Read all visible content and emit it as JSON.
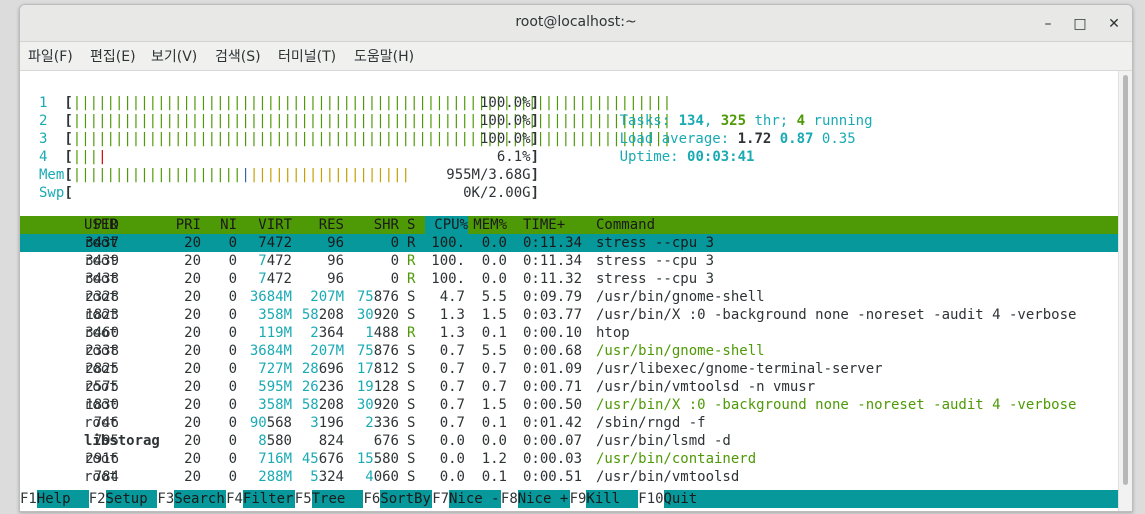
{
  "window": {
    "title": "root@localhost:~",
    "buttons": {
      "minimize": "–",
      "maximize": "□",
      "close": "✕"
    }
  },
  "menubar": [
    "파일(F)",
    "편집(E)",
    "보기(V)",
    "검색(S)",
    "터미널(T)",
    "도움말(H)"
  ],
  "meters": {
    "cpus": [
      {
        "num": "1",
        "percent": "100.0%",
        "green_bars": 71,
        "red_bars": 0
      },
      {
        "num": "2",
        "percent": "100.0%",
        "green_bars": 71,
        "red_bars": 0
      },
      {
        "num": "3",
        "percent": "100.0%",
        "green_bars": 71,
        "red_bars": 0
      },
      {
        "num": "4",
        "percent": "6.1%",
        "green_bars": 3,
        "red_bars": 1
      }
    ],
    "mem": {
      "label": "Mem",
      "value": "955M/3.68G",
      "green_bars": 20,
      "blue_bars": 1,
      "yellow_bars": 19
    },
    "swp": {
      "label": "Swp",
      "value": "0K/2.00G"
    }
  },
  "stats": {
    "tasks_label": "Tasks:",
    "tasks": "134",
    "thr": "325",
    "thr_label": "thr;",
    "running": "4",
    "running_label": "running",
    "load_label": "Load average:",
    "load1": "1.72",
    "load5": "0.87",
    "load15": "0.35",
    "uptime_label": "Uptime:",
    "uptime": "00:03:41"
  },
  "columns": [
    "PID",
    "USER",
    "PRI",
    "NI",
    "VIRT",
    "RES",
    "SHR",
    "S",
    "CPU%",
    "MEM%",
    "TIME+",
    "Command"
  ],
  "processes": [
    {
      "pid": "3437",
      "user": "root",
      "pri": "20",
      "ni": "0",
      "virt": "7472",
      "res": "96",
      "shr": "0",
      "s": "R",
      "cpu": "100.",
      "mem": "0.0",
      "time": "0:11.34",
      "cmd": "stress --cpu 3",
      "selected": true
    },
    {
      "pid": "3439",
      "user": "root",
      "pri": "20",
      "ni": "0",
      "virt": "7472",
      "res": "96",
      "shr": "0",
      "s": "R",
      "cpu": "100.",
      "mem": "0.0",
      "time": "0:11.34",
      "cmd": "stress --cpu 3"
    },
    {
      "pid": "3438",
      "user": "root",
      "pri": "20",
      "ni": "0",
      "virt": "7472",
      "res": "96",
      "shr": "0",
      "s": "R",
      "cpu": "100.",
      "mem": "0.0",
      "time": "0:11.32",
      "cmd": "stress --cpu 3"
    },
    {
      "pid": "2328",
      "user": "root",
      "pri": "20",
      "ni": "0",
      "virt": "3684M",
      "res": "207M",
      "shr": "75876",
      "s": "S",
      "cpu": "4.7",
      "mem": "5.5",
      "time": "0:09.79",
      "cmd": "/usr/bin/gnome-shell"
    },
    {
      "pid": "1823",
      "user": "root",
      "pri": "20",
      "ni": "0",
      "virt": "358M",
      "res": "58208",
      "shr": "30920",
      "s": "S",
      "cpu": "1.3",
      "mem": "1.5",
      "time": "0:03.77",
      "cmd": "/usr/bin/X :0 -background none -noreset -audit 4 -verbose"
    },
    {
      "pid": "3460",
      "user": "root",
      "pri": "20",
      "ni": "0",
      "virt": "119M",
      "res": "2364",
      "shr": "1488",
      "s": "R",
      "cpu": "1.3",
      "mem": "0.1",
      "time": "0:00.10",
      "cmd": "htop"
    },
    {
      "pid": "2338",
      "user": "root",
      "pri": "20",
      "ni": "0",
      "virt": "3684M",
      "res": "207M",
      "shr": "75876",
      "s": "S",
      "cpu": "0.7",
      "mem": "5.5",
      "time": "0:00.68",
      "cmd": "/usr/bin/gnome-shell",
      "thread": true
    },
    {
      "pid": "2825",
      "user": "root",
      "pri": "20",
      "ni": "0",
      "virt": "727M",
      "res": "28696",
      "shr": "17812",
      "s": "S",
      "cpu": "0.7",
      "mem": "0.7",
      "time": "0:01.09",
      "cmd": "/usr/libexec/gnome-terminal-server"
    },
    {
      "pid": "2575",
      "user": "root",
      "pri": "20",
      "ni": "0",
      "virt": "595M",
      "res": "26236",
      "shr": "19128",
      "s": "S",
      "cpu": "0.7",
      "mem": "0.7",
      "time": "0:00.71",
      "cmd": "/usr/bin/vmtoolsd -n vmusr"
    },
    {
      "pid": "1830",
      "user": "root",
      "pri": "20",
      "ni": "0",
      "virt": "358M",
      "res": "58208",
      "shr": "30920",
      "s": "S",
      "cpu": "0.7",
      "mem": "1.5",
      "time": "0:00.50",
      "cmd": "/usr/bin/X :0 -background none -noreset -audit 4 -verbose",
      "thread": true
    },
    {
      "pid": "746",
      "user": "root",
      "pri": "20",
      "ni": "0",
      "virt": "90568",
      "res": "3196",
      "shr": "2336",
      "s": "S",
      "cpu": "0.7",
      "mem": "0.1",
      "time": "0:01.42",
      "cmd": "/sbin/rngd -f"
    },
    {
      "pid": "795",
      "user": "libstorag",
      "pri": "20",
      "ni": "0",
      "virt": "8580",
      "res": "824",
      "shr": "676",
      "s": "S",
      "cpu": "0.0",
      "mem": "0.0",
      "time": "0:00.07",
      "cmd": "/usr/bin/lsmd -d",
      "bolduser": true
    },
    {
      "pid": "2916",
      "user": "root",
      "pri": "20",
      "ni": "0",
      "virt": "716M",
      "res": "45676",
      "shr": "15580",
      "s": "S",
      "cpu": "0.0",
      "mem": "1.2",
      "time": "0:00.03",
      "cmd": "/usr/bin/containerd",
      "thread": true
    },
    {
      "pid": "784",
      "user": "root",
      "pri": "20",
      "ni": "0",
      "virt": "288M",
      "res": "5324",
      "shr": "4060",
      "s": "S",
      "cpu": "0.0",
      "mem": "0.1",
      "time": "0:00.51",
      "cmd": "/usr/bin/vmtoolsd"
    }
  ],
  "function_keys": [
    {
      "key": "F1",
      "label": "Help"
    },
    {
      "key": "F2",
      "label": "Setup"
    },
    {
      "key": "F3",
      "label": "Search"
    },
    {
      "key": "F4",
      "label": "Filter"
    },
    {
      "key": "F5",
      "label": "Tree"
    },
    {
      "key": "F6",
      "label": "SortBy"
    },
    {
      "key": "F7",
      "label": "Nice -"
    },
    {
      "key": "F8",
      "label": "Nice +"
    },
    {
      "key": "F9",
      "label": "Kill"
    },
    {
      "key": "F10",
      "label": "Quit"
    }
  ],
  "colors": {
    "header_bg": "#4e9a06",
    "selected_bg": "#06989a",
    "cyan": "#1aaab4",
    "green": "#4e9a06"
  }
}
